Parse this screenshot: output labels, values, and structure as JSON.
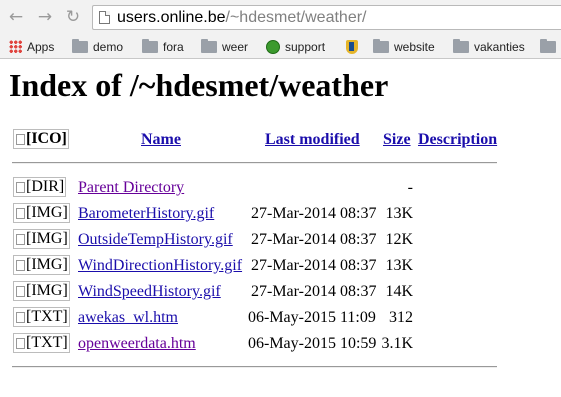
{
  "browser": {
    "url_host": "users.online.be",
    "url_path": "/~hdesmet/weather/",
    "bookmarks": [
      {
        "label": "Apps",
        "icon": "apps-grid-icon"
      },
      {
        "label": "demo",
        "icon": "folder-icon"
      },
      {
        "label": "fora",
        "icon": "folder-icon"
      },
      {
        "label": "weer",
        "icon": "folder-icon"
      },
      {
        "label": "support",
        "icon": "support-icon"
      },
      {
        "label": "",
        "icon": "shield-icon"
      },
      {
        "label": "website",
        "icon": "folder-icon"
      },
      {
        "label": "vakanties",
        "icon": "folder-icon"
      },
      {
        "label": "",
        "icon": "folder-icon"
      }
    ]
  },
  "page": {
    "title": "Index of /~hdesmet/weather",
    "header_icon_alt": "[ICO]",
    "columns": {
      "name": "Name",
      "modified": "Last modified",
      "size": "Size",
      "description": "Description"
    },
    "rows": [
      {
        "alt": "[DIR]",
        "name": "Parent Directory",
        "modified": "",
        "size": "-",
        "visited": true
      },
      {
        "alt": "[IMG]",
        "name": "BarometerHistory.gif",
        "modified": "27-Mar-2014 08:37",
        "size": "13K",
        "visited": false
      },
      {
        "alt": "[IMG]",
        "name": "OutsideTempHistory.gif",
        "modified": "27-Mar-2014 08:37",
        "size": "12K",
        "visited": false
      },
      {
        "alt": "[IMG]",
        "name": "WindDirectionHistory.gif",
        "modified": "27-Mar-2014 08:37",
        "size": "13K",
        "visited": false
      },
      {
        "alt": "[IMG]",
        "name": "WindSpeedHistory.gif",
        "modified": "27-Mar-2014 08:37",
        "size": "14K",
        "visited": false
      },
      {
        "alt": "[TXT]",
        "name": "awekas_wl.htm",
        "modified": "06-May-2015 11:09",
        "size": "312",
        "visited": false
      },
      {
        "alt": "[TXT]",
        "name": "openweerdata.htm",
        "modified": "06-May-2015 10:59",
        "size": "3.1K",
        "visited": true
      }
    ]
  }
}
